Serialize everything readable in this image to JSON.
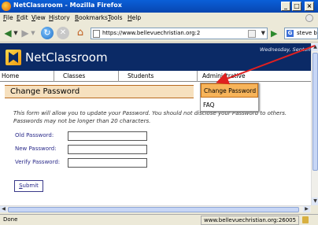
{
  "window": {
    "title": "NetClassroom - Mozilla Firefox",
    "minimize": "_",
    "maximize": "□",
    "close": "×"
  },
  "menubar": [
    "File",
    "Edit",
    "View",
    "History",
    "Bookmarks",
    "Tools",
    "Help"
  ],
  "toolbar": {
    "back": "◀",
    "forward": "▶",
    "dropdown": "▼",
    "reload": "↻",
    "stop": "✕",
    "home": "⌂",
    "url": "https://www.bellevuechristian.org:2",
    "go": "▶",
    "search_engine": "G",
    "search_value": "steve balmer"
  },
  "site": {
    "name": "NetClassroom",
    "date": "Wednesday, September",
    "nav": [
      "Home",
      "Classes",
      "Students",
      "Administrative"
    ]
  },
  "dropdown": {
    "items": [
      "Change Password",
      "FAQ"
    ]
  },
  "form": {
    "heading": "Change Password",
    "intro_line1": "This form will allow you to update your Password. You should not disclose your Password to others.",
    "intro_line2": "Passwords may not be longer than 20 characters.",
    "labels": [
      "Old Password:",
      "New Password:",
      "Verify Password:"
    ],
    "values": [
      "",
      "",
      ""
    ],
    "submit": "Submit"
  },
  "status": {
    "text": "Done",
    "host": "www.bellevuechristian.org:26005"
  },
  "colors": {
    "header_bg": "#0b2a66",
    "accent_orange": "#f7b45a",
    "annotation_arrow": "#e02020"
  },
  "icons": {
    "logo": "netclassroom-logo-icon",
    "lock": "lock-icon"
  }
}
